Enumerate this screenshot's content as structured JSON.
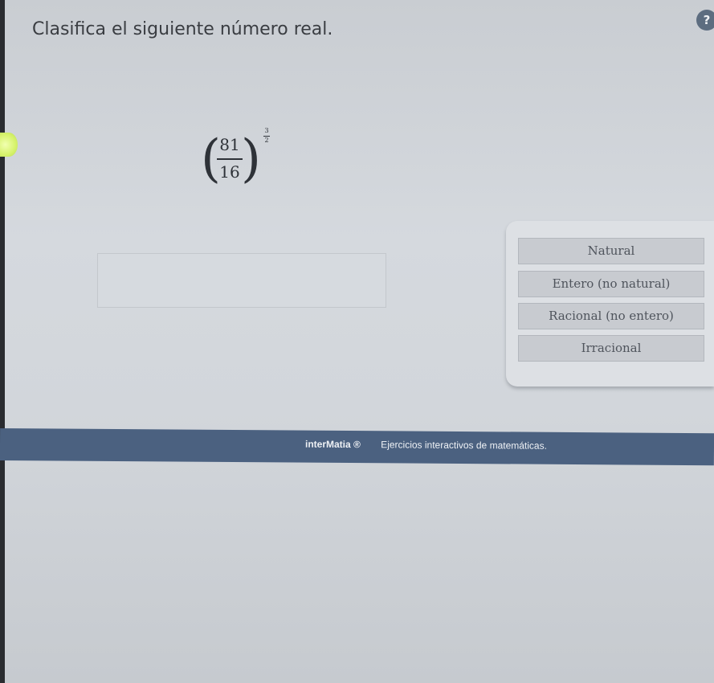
{
  "header": {
    "title": "Clasifica el siguiente número real."
  },
  "expression": {
    "numerator": "81",
    "denominator": "16",
    "exponent_numerator": "3",
    "exponent_denominator": "2"
  },
  "answer_box": {
    "value": ""
  },
  "options": [
    {
      "label": "Natural"
    },
    {
      "label": "Entero (no natural)"
    },
    {
      "label": "Racional (no entero)"
    },
    {
      "label": "Irracional"
    }
  ],
  "help": {
    "icon": "help-icon",
    "label": "?"
  },
  "footer": {
    "brand": "interMatia ®",
    "tagline": "Ejercicios interactivos de matemáticas."
  },
  "colors": {
    "background": "#d2d6db",
    "footer_bar": "#4b6180",
    "option_bg": "#c8cbd0",
    "help_icon": "#5d6d80"
  }
}
